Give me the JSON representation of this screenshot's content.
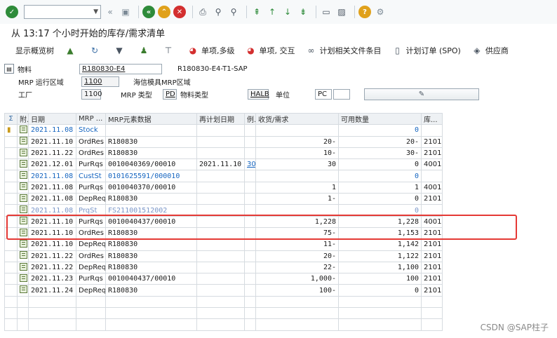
{
  "title": "从 13:17 个小时开始的库存/需求清单",
  "toolbar": {
    "summary_display": "显示概览树",
    "single_multi": "单项,多级",
    "single_interactive": "单项, 交互",
    "plan_files": "计划相关文件条目",
    "planned_order": "计划订单 (SPO)",
    "supplier": "供应商"
  },
  "header": {
    "material_label": "物料",
    "material_value": "R180830-E4",
    "material_desc": "R180830-E4-T1-SAP",
    "mrp_area_label": "MRP 运行区域",
    "mrp_area_value": "1100",
    "mrp_area_desc": "海信模具MRP区域",
    "plant_label": "工厂",
    "plant_value": "1100",
    "mrp_type_label": "MRP 类型",
    "mrp_type_value": "PD",
    "material_type_label": "物料类型",
    "material_type_value": "HALB",
    "unit_label": "单位",
    "unit_value": "PC"
  },
  "table": {
    "columns": [
      "附.",
      "日期",
      "MRP ...",
      "MRP元素数据",
      "再计划日期",
      "例.",
      "收货/需求",
      "可用数量",
      "库..."
    ],
    "rows": [
      {
        "date": "2021.11.08",
        "mrp": "Stock",
        "data": "",
        "resched": "",
        "ex": "",
        "qty": "",
        "avail": "0",
        "stor": "",
        "style": "blue"
      },
      {
        "date": "2021.11.10",
        "mrp": "OrdRes",
        "data": "R180830",
        "resched": "",
        "ex": "",
        "qty": "20-",
        "avail": "20-",
        "stor": "2101",
        "style": ""
      },
      {
        "date": "2021.11.22",
        "mrp": "OrdRes",
        "data": "R180830",
        "resched": "",
        "ex": "",
        "qty": "10-",
        "avail": "30-",
        "stor": "2101",
        "style": ""
      },
      {
        "date": "2021.12.01",
        "mrp": "PurRqs",
        "data": "0010040369/00010",
        "resched": "2021.11.10",
        "ex": "30",
        "qty": "30",
        "avail": "0",
        "stor": "4001",
        "style": ""
      },
      {
        "date": "2021.11.08",
        "mrp": "CustSt",
        "data": "0101625591/000010",
        "resched": "",
        "ex": "",
        "qty": "",
        "avail": "0",
        "stor": "",
        "style": "blue"
      },
      {
        "date": "2021.11.08",
        "mrp": "PurRqs",
        "data": "0010040370/00010",
        "resched": "",
        "ex": "",
        "qty": "1",
        "avail": "1",
        "stor": "4001",
        "style": ""
      },
      {
        "date": "2021.11.08",
        "mrp": "DepReq",
        "data": "R180830",
        "resched": "",
        "ex": "",
        "qty": "1-",
        "avail": "0",
        "stor": "2101",
        "style": ""
      },
      {
        "date": "2021.11.08",
        "mrp": "PrqSt",
        "data": "FS211001512002",
        "resched": "",
        "ex": "",
        "qty": "",
        "avail": "0",
        "stor": "",
        "style": "faded"
      },
      {
        "date": "2021.11.10",
        "mrp": "PurRqs",
        "data": "0010040437/00010",
        "resched": "",
        "ex": "",
        "qty": "1,228",
        "avail": "1,228",
        "stor": "4001",
        "style": ""
      },
      {
        "date": "2021.11.10",
        "mrp": "OrdRes",
        "data": "R180830",
        "resched": "",
        "ex": "",
        "qty": "75-",
        "avail": "1,153",
        "stor": "2101",
        "style": ""
      },
      {
        "date": "2021.11.10",
        "mrp": "DepReq",
        "data": "R180830",
        "resched": "",
        "ex": "",
        "qty": "11-",
        "avail": "1,142",
        "stor": "2101",
        "style": ""
      },
      {
        "date": "2021.11.22",
        "mrp": "OrdRes",
        "data": "R180830",
        "resched": "",
        "ex": "",
        "qty": "20-",
        "avail": "1,122",
        "stor": "2101",
        "style": ""
      },
      {
        "date": "2021.11.22",
        "mrp": "DepReq",
        "data": "R180830",
        "resched": "",
        "ex": "",
        "qty": "22-",
        "avail": "1,100",
        "stor": "2101",
        "style": ""
      },
      {
        "date": "2021.11.23",
        "mrp": "PurRqs",
        "data": "0010040437/00010",
        "resched": "",
        "ex": "",
        "qty": "1,000-",
        "avail": "100",
        "stor": "2101",
        "style": ""
      },
      {
        "date": "2021.11.24",
        "mrp": "DepReq",
        "data": "R180830",
        "resched": "",
        "ex": "",
        "qty": "100-",
        "avail": "0",
        "stor": "2101",
        "style": ""
      }
    ]
  },
  "watermark": "CSDN @SAP柱子"
}
